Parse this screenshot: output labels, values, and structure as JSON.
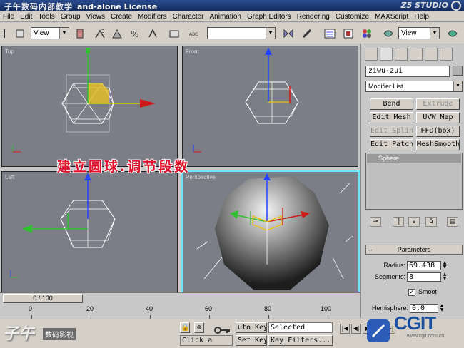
{
  "title_bar": {
    "brand_left": "子午数码内部教学",
    "title": "and-alone License",
    "brand_right": "Z5 STUDIO"
  },
  "menu": [
    "File",
    "Edit",
    "Tools",
    "Group",
    "Views",
    "Create",
    "Modifiers",
    "Character",
    "Animation",
    "Graph Editors",
    "Rendering",
    "Customize",
    "MAXScript",
    "Help"
  ],
  "toolbar": {
    "view_dropdown_1": "View",
    "view_dropdown_2": "View"
  },
  "viewports": {
    "top": "Top",
    "front": "Front",
    "left": "Left",
    "perspective": "Perspective"
  },
  "banner": "建立圆球.调节段数",
  "command_panel": {
    "object_name": "ziwu-zui",
    "modifier_list": "Modifier List",
    "buttons": [
      {
        "label": "Bend",
        "disabled": false
      },
      {
        "label": "Extrude",
        "disabled": true
      },
      {
        "label": "Edit Mesh",
        "disabled": false
      },
      {
        "label": "UVW Map",
        "disabled": false
      },
      {
        "label": "Edit Spline",
        "disabled": true
      },
      {
        "label": "FFD(box)",
        "disabled": false
      },
      {
        "label": "Edit Patch",
        "disabled": false
      },
      {
        "label": "MeshSmooth",
        "disabled": false
      }
    ],
    "stack_item": "Sphere",
    "parameters_title": "Parameters",
    "radius_label": "Radius:",
    "radius_value": "69.438",
    "segments_label": "Segments:",
    "segments_value": "8",
    "smooth_label": "Smoot",
    "smooth_checked": "✓",
    "hemisphere_label": "Hemisphere:",
    "hemisphere_value": "0.0"
  },
  "timeline": {
    "frame": "0 / 100",
    "ticks": [
      "0",
      "20",
      "40",
      "60",
      "80",
      "100"
    ]
  },
  "status": {
    "logo_cn": "子午",
    "logo_sub": "数码影视",
    "auto_key": "uto Key",
    "set_key": "Set Key",
    "selected": "Selected",
    "key_filters": "Key Filters...",
    "click_prompt": "Click a",
    "cg_text": "CGIT",
    "cg_url": "www.cgit.com.cn"
  },
  "colors": {
    "x_axis": "#d01818",
    "y_axis": "#22aa22",
    "z_axis": "#2244ff",
    "viewport_bg": "#7b7e87",
    "active_border": "#6fe3ff"
  }
}
